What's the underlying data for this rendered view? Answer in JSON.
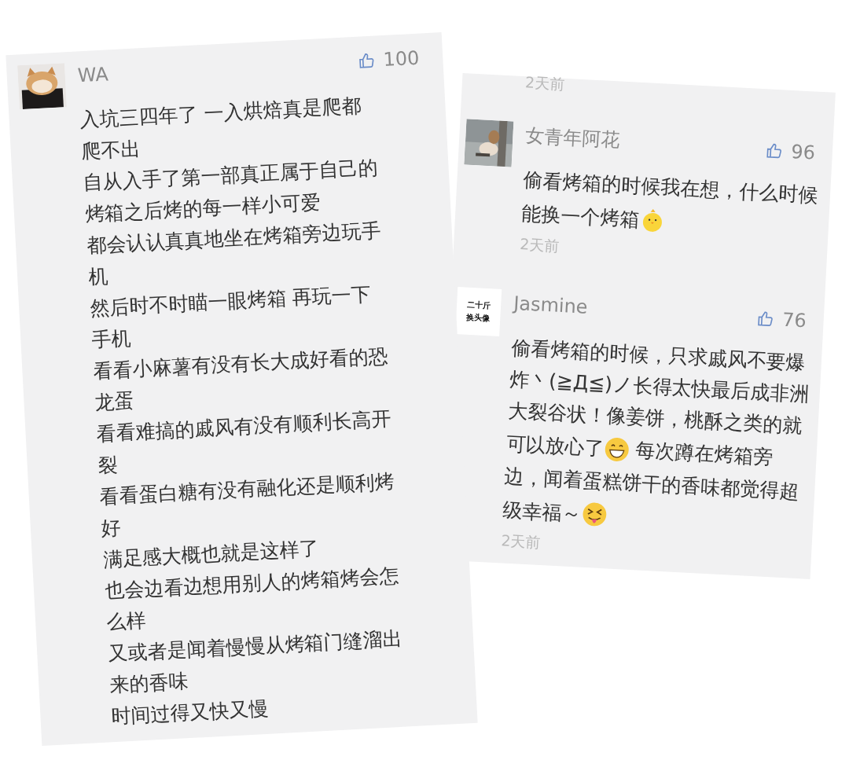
{
  "left_card": {
    "avatar": {
      "kind": "picture"
    },
    "user": "WA",
    "likes": "100",
    "lines": [
      "入坑三四年了 一入烘焙真是爬都",
      "爬不出",
      "自从入手了第一部真正属于自己的",
      "烤箱之后烤的每一样小可爱",
      "都会认认真真地坐在烤箱旁边玩手",
      "机",
      "然后时不时瞄一眼烤箱 再玩一下",
      "手机",
      "看看小麻薯有没有长大成好看的恐",
      "龙蛋",
      "看看难搞的戚风有没有顺利长高开",
      "裂",
      "看看蛋白糖有没有融化还是顺利烤",
      "好",
      "满足感大概也就是这样了",
      "也会边看边想用别人的烤箱烤会怎",
      "么样",
      "又或者是闻着慢慢从烤箱门缝溜出",
      "来的香味",
      "时间过得又快又慢"
    ]
  },
  "right_card": {
    "top_time": "2天前",
    "comments": [
      {
        "avatar": {
          "kind": "picture"
        },
        "user": "女青年阿花",
        "likes": "96",
        "time": "2天前",
        "lines": [
          [
            {
              "text": "偷看烤箱的时候我在想，什么时候"
            }
          ],
          [
            {
              "text": "能换一个烤箱"
            },
            {
              "kind": "chick"
            }
          ]
        ]
      },
      {
        "avatar": {
          "kind": "text",
          "lines": [
            "二十斤",
            "换头像"
          ]
        },
        "user": "Jasmine",
        "likes": "76",
        "time": "2天前",
        "lines": [
          [
            {
              "text": "偷看烤箱的时候，只求戚风不要爆"
            }
          ],
          [
            {
              "text": "炸丶(≧Д≦)ノ长得太快最后成非洲"
            }
          ],
          [
            {
              "text": "大裂谷状！像姜饼，桃酥之类的就"
            }
          ],
          [
            {
              "text": "可以放心了"
            },
            {
              "kind": "grin"
            },
            {
              "text": " 每次蹲在烤箱旁"
            }
          ],
          [
            {
              "text": "边，闻着蛋糕饼干的香味都觉得超"
            }
          ],
          [
            {
              "text": "级幸福～"
            },
            {
              "kind": "tongue"
            }
          ]
        ]
      }
    ]
  }
}
